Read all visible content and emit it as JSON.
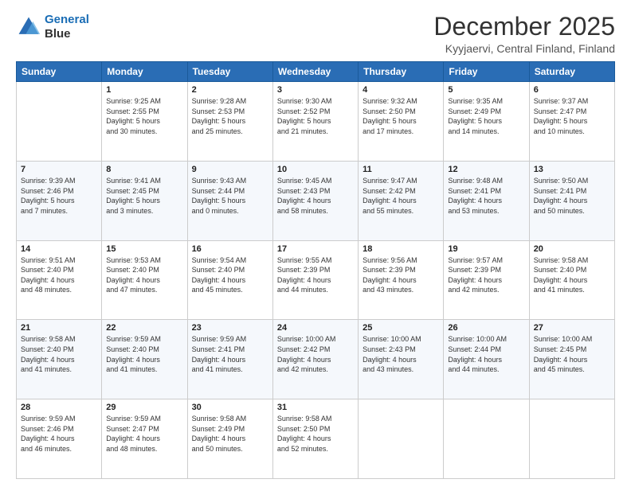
{
  "header": {
    "logo_line1": "General",
    "logo_line2": "Blue",
    "title": "December 2025",
    "subtitle": "Kyyjaervi, Central Finland, Finland"
  },
  "weekdays": [
    "Sunday",
    "Monday",
    "Tuesday",
    "Wednesday",
    "Thursday",
    "Friday",
    "Saturday"
  ],
  "weeks": [
    [
      {
        "day": "",
        "info": ""
      },
      {
        "day": "1",
        "info": "Sunrise: 9:25 AM\nSunset: 2:55 PM\nDaylight: 5 hours\nand 30 minutes."
      },
      {
        "day": "2",
        "info": "Sunrise: 9:28 AM\nSunset: 2:53 PM\nDaylight: 5 hours\nand 25 minutes."
      },
      {
        "day": "3",
        "info": "Sunrise: 9:30 AM\nSunset: 2:52 PM\nDaylight: 5 hours\nand 21 minutes."
      },
      {
        "day": "4",
        "info": "Sunrise: 9:32 AM\nSunset: 2:50 PM\nDaylight: 5 hours\nand 17 minutes."
      },
      {
        "day": "5",
        "info": "Sunrise: 9:35 AM\nSunset: 2:49 PM\nDaylight: 5 hours\nand 14 minutes."
      },
      {
        "day": "6",
        "info": "Sunrise: 9:37 AM\nSunset: 2:47 PM\nDaylight: 5 hours\nand 10 minutes."
      }
    ],
    [
      {
        "day": "7",
        "info": "Sunrise: 9:39 AM\nSunset: 2:46 PM\nDaylight: 5 hours\nand 7 minutes."
      },
      {
        "day": "8",
        "info": "Sunrise: 9:41 AM\nSunset: 2:45 PM\nDaylight: 5 hours\nand 3 minutes."
      },
      {
        "day": "9",
        "info": "Sunrise: 9:43 AM\nSunset: 2:44 PM\nDaylight: 5 hours\nand 0 minutes."
      },
      {
        "day": "10",
        "info": "Sunrise: 9:45 AM\nSunset: 2:43 PM\nDaylight: 4 hours\nand 58 minutes."
      },
      {
        "day": "11",
        "info": "Sunrise: 9:47 AM\nSunset: 2:42 PM\nDaylight: 4 hours\nand 55 minutes."
      },
      {
        "day": "12",
        "info": "Sunrise: 9:48 AM\nSunset: 2:41 PM\nDaylight: 4 hours\nand 53 minutes."
      },
      {
        "day": "13",
        "info": "Sunrise: 9:50 AM\nSunset: 2:41 PM\nDaylight: 4 hours\nand 50 minutes."
      }
    ],
    [
      {
        "day": "14",
        "info": "Sunrise: 9:51 AM\nSunset: 2:40 PM\nDaylight: 4 hours\nand 48 minutes."
      },
      {
        "day": "15",
        "info": "Sunrise: 9:53 AM\nSunset: 2:40 PM\nDaylight: 4 hours\nand 47 minutes."
      },
      {
        "day": "16",
        "info": "Sunrise: 9:54 AM\nSunset: 2:40 PM\nDaylight: 4 hours\nand 45 minutes."
      },
      {
        "day": "17",
        "info": "Sunrise: 9:55 AM\nSunset: 2:39 PM\nDaylight: 4 hours\nand 44 minutes."
      },
      {
        "day": "18",
        "info": "Sunrise: 9:56 AM\nSunset: 2:39 PM\nDaylight: 4 hours\nand 43 minutes."
      },
      {
        "day": "19",
        "info": "Sunrise: 9:57 AM\nSunset: 2:39 PM\nDaylight: 4 hours\nand 42 minutes."
      },
      {
        "day": "20",
        "info": "Sunrise: 9:58 AM\nSunset: 2:40 PM\nDaylight: 4 hours\nand 41 minutes."
      }
    ],
    [
      {
        "day": "21",
        "info": "Sunrise: 9:58 AM\nSunset: 2:40 PM\nDaylight: 4 hours\nand 41 minutes."
      },
      {
        "day": "22",
        "info": "Sunrise: 9:59 AM\nSunset: 2:40 PM\nDaylight: 4 hours\nand 41 minutes."
      },
      {
        "day": "23",
        "info": "Sunrise: 9:59 AM\nSunset: 2:41 PM\nDaylight: 4 hours\nand 41 minutes."
      },
      {
        "day": "24",
        "info": "Sunrise: 10:00 AM\nSunset: 2:42 PM\nDaylight: 4 hours\nand 42 minutes."
      },
      {
        "day": "25",
        "info": "Sunrise: 10:00 AM\nSunset: 2:43 PM\nDaylight: 4 hours\nand 43 minutes."
      },
      {
        "day": "26",
        "info": "Sunrise: 10:00 AM\nSunset: 2:44 PM\nDaylight: 4 hours\nand 44 minutes."
      },
      {
        "day": "27",
        "info": "Sunrise: 10:00 AM\nSunset: 2:45 PM\nDaylight: 4 hours\nand 45 minutes."
      }
    ],
    [
      {
        "day": "28",
        "info": "Sunrise: 9:59 AM\nSunset: 2:46 PM\nDaylight: 4 hours\nand 46 minutes."
      },
      {
        "day": "29",
        "info": "Sunrise: 9:59 AM\nSunset: 2:47 PM\nDaylight: 4 hours\nand 48 minutes."
      },
      {
        "day": "30",
        "info": "Sunrise: 9:58 AM\nSunset: 2:49 PM\nDaylight: 4 hours\nand 50 minutes."
      },
      {
        "day": "31",
        "info": "Sunrise: 9:58 AM\nSunset: 2:50 PM\nDaylight: 4 hours\nand 52 minutes."
      },
      {
        "day": "",
        "info": ""
      },
      {
        "day": "",
        "info": ""
      },
      {
        "day": "",
        "info": ""
      }
    ]
  ]
}
